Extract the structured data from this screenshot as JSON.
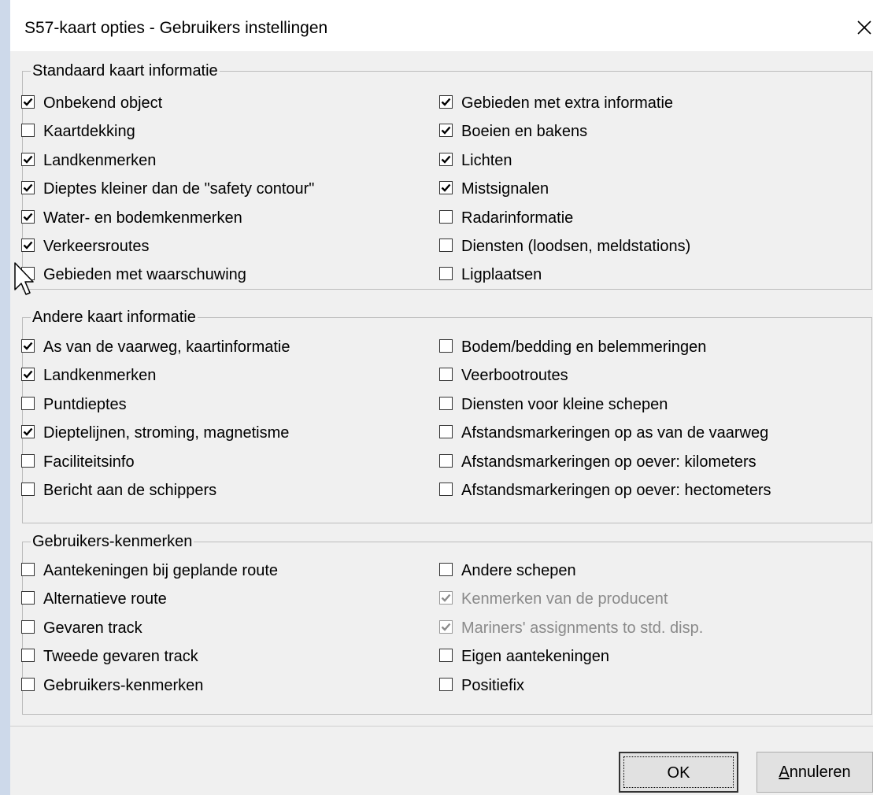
{
  "window": {
    "title": "S57-kaart opties - Gebruikers instellingen",
    "close_icon": "close-icon"
  },
  "groups": {
    "standard": {
      "legend": "Standaard kaart informatie",
      "left": [
        {
          "label": "Onbekend object",
          "checked": true
        },
        {
          "label": "Kaartdekking",
          "checked": false
        },
        {
          "label": "Landkenmerken",
          "checked": true
        },
        {
          "label": "Dieptes kleiner dan de \"safety contour\"",
          "checked": true
        },
        {
          "label": "Water- en bodemkenmerken",
          "checked": true
        },
        {
          "label": "Verkeersroutes",
          "checked": true
        },
        {
          "label": "Gebieden met waarschuwing",
          "checked": false
        }
      ],
      "right": [
        {
          "label": "Gebieden met extra informatie",
          "checked": true
        },
        {
          "label": "Boeien en bakens",
          "checked": true
        },
        {
          "label": "Lichten",
          "checked": true
        },
        {
          "label": "Mistsignalen",
          "checked": true
        },
        {
          "label": "Radarinformatie",
          "checked": false
        },
        {
          "label": "Diensten (loodsen, meldstations)",
          "checked": false
        },
        {
          "label": "Ligplaatsen",
          "checked": false
        }
      ]
    },
    "other": {
      "legend": "Andere kaart informatie",
      "left": [
        {
          "label": "As van de vaarweg, kaartinformatie",
          "checked": true
        },
        {
          "label": "Landkenmerken",
          "checked": true
        },
        {
          "label": "Puntdieptes",
          "checked": false
        },
        {
          "label": "Dieptelijnen, stroming, magnetisme",
          "checked": true
        },
        {
          "label": "Faciliteitsinfo",
          "checked": false
        },
        {
          "label": "Bericht aan de schippers",
          "checked": false
        }
      ],
      "right": [
        {
          "label": "Bodem/bedding en belemmeringen",
          "checked": false
        },
        {
          "label": "Veerbootroutes",
          "checked": false
        },
        {
          "label": "Diensten voor kleine schepen",
          "checked": false
        },
        {
          "label": "Afstandsmarkeringen op as van de vaarweg",
          "checked": false
        },
        {
          "label": "Afstandsmarkeringen op oever: kilometers",
          "checked": false
        },
        {
          "label": "Afstandsmarkeringen op oever: hectometers",
          "checked": false
        }
      ]
    },
    "user": {
      "legend": "Gebruikers-kenmerken",
      "left": [
        {
          "label": "Aantekeningen bij geplande route",
          "checked": false
        },
        {
          "label": "Alternatieve route",
          "checked": false
        },
        {
          "label": "Gevaren track",
          "checked": false
        },
        {
          "label": "Tweede gevaren track",
          "checked": false
        },
        {
          "label": "Gebruikers-kenmerken",
          "checked": false
        }
      ],
      "right": [
        {
          "label": "Andere schepen",
          "checked": false
        },
        {
          "label": "Kenmerken van de producent",
          "checked": true,
          "disabled": true
        },
        {
          "label": "Mariners' assignments to std. disp.",
          "checked": true,
          "disabled": true
        },
        {
          "label": "Eigen aantekeningen",
          "checked": false
        },
        {
          "label": "Positiefix",
          "checked": false
        }
      ]
    }
  },
  "buttons": {
    "ok": "OK",
    "cancel_accel": "A",
    "cancel_rest": "nnuleren"
  },
  "colors": {
    "background": "#cdd9ea",
    "dialog": "#f0f0f0",
    "disabled_text": "#8a8a8a"
  }
}
